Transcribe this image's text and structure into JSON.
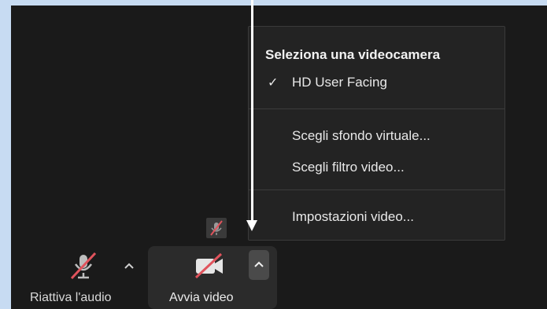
{
  "camera_menu": {
    "heading": "Seleziona una videocamera",
    "selected_check": "✓",
    "camera_option": "HD User Facing",
    "items": [
      "Scegli sfondo virtuale...",
      "Scegli filtro video..."
    ],
    "settings": "Impostazioni video..."
  },
  "toolbar": {
    "audio_label": "Riattiva l'audio",
    "video_label": "Avvia video"
  },
  "colors": {
    "toolbar_bg": "#1a1a1a",
    "menu_bg": "#232323",
    "muted_red": "#e0535c",
    "page_bg": "#c7dbf2"
  },
  "icons": [
    "microphone-muted-icon",
    "chevron-up-icon",
    "video-camera-off-icon",
    "mute-indicator-icon",
    "checkmark-icon"
  ]
}
